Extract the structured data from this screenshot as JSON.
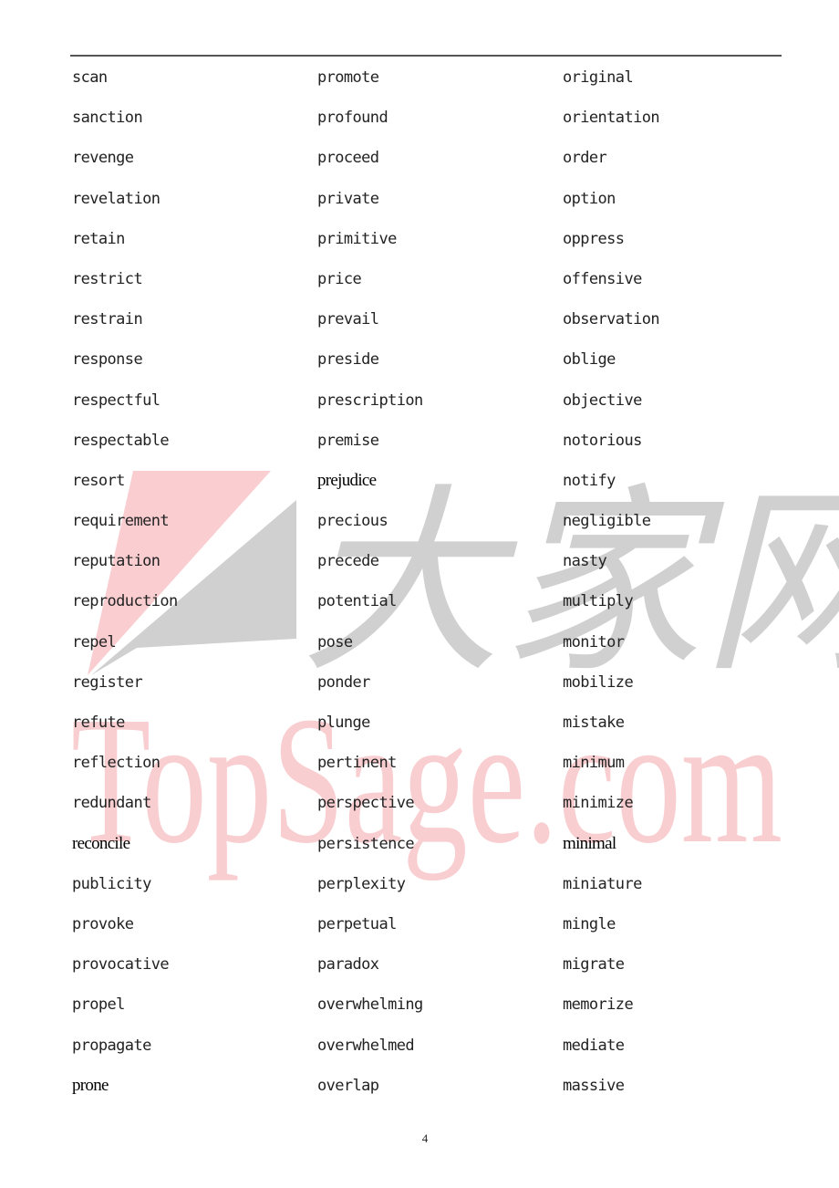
{
  "document": {
    "columns": [
      {
        "words": [
          {
            "text": "scan",
            "style": "mono"
          },
          {
            "text": "sanction",
            "style": "mono"
          },
          {
            "text": "revenge",
            "style": "mono"
          },
          {
            "text": "revelation",
            "style": "mono"
          },
          {
            "text": "retain",
            "style": "mono"
          },
          {
            "text": "restrict",
            "style": "mono"
          },
          {
            "text": "restrain",
            "style": "mono"
          },
          {
            "text": "response",
            "style": "mono"
          },
          {
            "text": "respectful",
            "style": "mono"
          },
          {
            "text": "respectable",
            "style": "mono"
          },
          {
            "text": "resort",
            "style": "mono"
          },
          {
            "text": "requirement",
            "style": "mono"
          },
          {
            "text": "reputation",
            "style": "mono"
          },
          {
            "text": "reproduction",
            "style": "mono"
          },
          {
            "text": "repel",
            "style": "mono"
          },
          {
            "text": "register",
            "style": "mono"
          },
          {
            "text": "refute",
            "style": "mono"
          },
          {
            "text": "reflection",
            "style": "mono"
          },
          {
            "text": "redundant",
            "style": "mono"
          },
          {
            "text": "reconcile",
            "style": "serif"
          },
          {
            "text": "publicity",
            "style": "mono"
          },
          {
            "text": "provoke",
            "style": "mono"
          },
          {
            "text": "provocative",
            "style": "mono"
          },
          {
            "text": "propel",
            "style": "mono"
          },
          {
            "text": "propagate",
            "style": "mono"
          },
          {
            "text": "prone",
            "style": "serif"
          }
        ]
      },
      {
        "words": [
          {
            "text": "promote",
            "style": "mono"
          },
          {
            "text": "profound",
            "style": "mono"
          },
          {
            "text": "proceed",
            "style": "mono"
          },
          {
            "text": "private",
            "style": "mono"
          },
          {
            "text": "primitive",
            "style": "mono"
          },
          {
            "text": "price",
            "style": "mono"
          },
          {
            "text": "prevail",
            "style": "mono"
          },
          {
            "text": "preside",
            "style": "mono"
          },
          {
            "text": "prescription",
            "style": "mono"
          },
          {
            "text": "premise",
            "style": "mono"
          },
          {
            "text": "prejudice",
            "style": "serif"
          },
          {
            "text": "precious",
            "style": "mono"
          },
          {
            "text": "precede",
            "style": "mono"
          },
          {
            "text": "potential",
            "style": "mono"
          },
          {
            "text": "pose",
            "style": "mono"
          },
          {
            "text": "ponder",
            "style": "mono"
          },
          {
            "text": "plunge",
            "style": "mono"
          },
          {
            "text": "pertinent",
            "style": "mono"
          },
          {
            "text": "perspective",
            "style": "mono"
          },
          {
            "text": "persistence",
            "style": "mono"
          },
          {
            "text": "perplexity",
            "style": "mono"
          },
          {
            "text": "perpetual",
            "style": "mono"
          },
          {
            "text": "paradox",
            "style": "mono"
          },
          {
            "text": "overwhelming",
            "style": "mono"
          },
          {
            "text": "overwhelmed",
            "style": "mono"
          },
          {
            "text": "overlap",
            "style": "mono"
          }
        ]
      },
      {
        "words": [
          {
            "text": "original",
            "style": "mono"
          },
          {
            "text": "orientation",
            "style": "mono"
          },
          {
            "text": "order",
            "style": "mono"
          },
          {
            "text": "option",
            "style": "mono"
          },
          {
            "text": "oppress",
            "style": "mono"
          },
          {
            "text": "offensive",
            "style": "mono"
          },
          {
            "text": "observation",
            "style": "mono"
          },
          {
            "text": "oblige",
            "style": "mono"
          },
          {
            "text": "objective",
            "style": "mono"
          },
          {
            "text": "notorious",
            "style": "mono"
          },
          {
            "text": "notify",
            "style": "mono"
          },
          {
            "text": "negligible",
            "style": "mono"
          },
          {
            "text": "nasty",
            "style": "mono"
          },
          {
            "text": "multiply",
            "style": "mono"
          },
          {
            "text": "monitor",
            "style": "mono"
          },
          {
            "text": "mobilize",
            "style": "mono"
          },
          {
            "text": "mistake",
            "style": "mono"
          },
          {
            "text": "minimum",
            "style": "mono"
          },
          {
            "text": "minimize",
            "style": "mono"
          },
          {
            "text": "minimal",
            "style": "serif"
          },
          {
            "text": "miniature",
            "style": "mono"
          },
          {
            "text": "mingle",
            "style": "mono"
          },
          {
            "text": "migrate",
            "style": "mono"
          },
          {
            "text": "memorize",
            "style": "mono"
          },
          {
            "text": "mediate",
            "style": "mono"
          },
          {
            "text": "massive",
            "style": "mono"
          }
        ]
      }
    ],
    "page_number": "4"
  },
  "watermark": {
    "text_latin": "TopSage.com",
    "text_cjk": "大家网",
    "colors": {
      "pink": "#f9c6c9",
      "gray": "#c8c8c8"
    }
  }
}
